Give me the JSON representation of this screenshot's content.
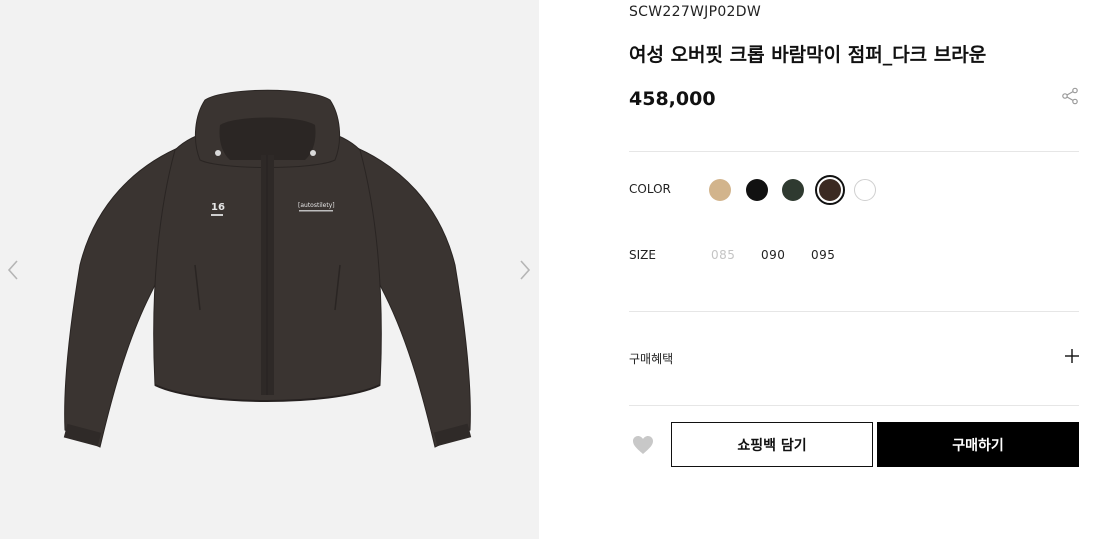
{
  "product": {
    "sku": "SCW227WJP02DW",
    "title": "여성 오버핏 크롭 바람막이 점퍼_다크 브라운",
    "price": "458,000"
  },
  "options": {
    "color_label": "COLOR",
    "colors": [
      {
        "name": "beige",
        "hex": "#d2b48c"
      },
      {
        "name": "black",
        "hex": "#111111"
      },
      {
        "name": "dark-green",
        "hex": "#2f3a30"
      },
      {
        "name": "dark-brown",
        "hex": "#3b2a22",
        "selected": true
      },
      {
        "name": "white",
        "hex": "#ffffff"
      }
    ],
    "size_label": "SIZE",
    "sizes": [
      {
        "label": "085",
        "available": false
      },
      {
        "label": "090",
        "available": true
      },
      {
        "label": "095",
        "available": true
      }
    ]
  },
  "benefits": {
    "label": "구매혜택"
  },
  "actions": {
    "cart_label": "쇼핑백 담기",
    "buy_label": "구매하기"
  },
  "image": {
    "logo_text": "[autostilety]",
    "number_text": "16",
    "jacket_color": "#3a3431"
  }
}
